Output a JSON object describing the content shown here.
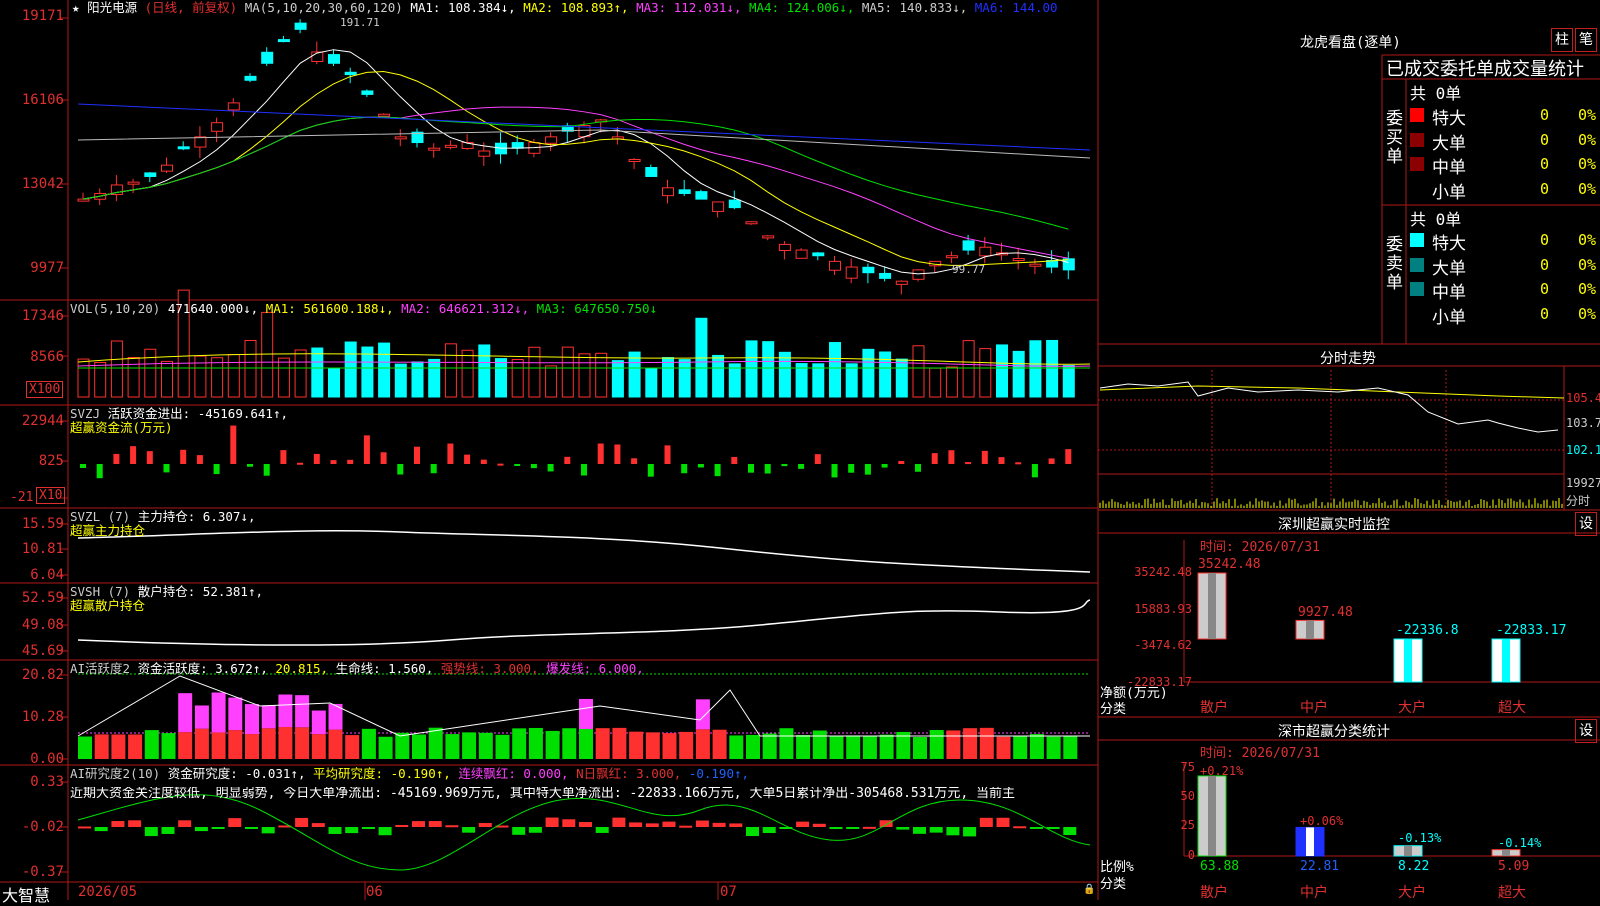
{
  "colors": {
    "up": "#ff3030",
    "down": "#00ffff",
    "grid": "#b01818",
    "white": "#ffffff",
    "yellow": "#ffff00",
    "magenta": "#ff40ff",
    "green": "#00e000",
    "blue": "#2030ff",
    "gray": "#bbbbbb"
  },
  "kline": {
    "stock_star": "★",
    "stock_name": "阳光电源",
    "mode": "(日线, 前复权)",
    "ma_label": "MA(5,10,20,30,60,120)",
    "ma1": "MA1: 108.384↓,",
    "ma2": "MA2: 108.893↑,",
    "ma3": "MA3: 112.031↓,",
    "ma4": "MA4: 124.006↓,",
    "ma5": "MA5: 140.833↓,",
    "ma6": "MA6: 144.00",
    "axis": [
      "19171",
      "16106",
      "13042",
      "9977"
    ],
    "high_mark": "191.71",
    "low_mark": "99.77"
  },
  "vol": {
    "title": "VOL(5,10,20)",
    "v": "471640.000↓,",
    "ma1": "MA1: 561600.188↓,",
    "ma2": "MA2: 646621.312↓,",
    "ma3": "MA3: 647650.750↓",
    "axis": [
      "17346",
      "8566"
    ],
    "unit": "X100"
  },
  "svzj": {
    "title": "SVZJ",
    "value": "活跃资金进出: -45169.641↑,",
    "sub": "超赢资金流(万元)",
    "axis": [
      "22944",
      "825",
      "-21"
    ],
    "unit": "X10"
  },
  "svzl": {
    "title": "SVZL (7)",
    "value": "主力持仓: 6.307↓,",
    "sub": "超赢主力持仓",
    "axis": [
      "15.59",
      "10.81",
      "6.04"
    ]
  },
  "svsh": {
    "title": "SVSH (7)",
    "value": "散户持仓: 52.381↑,",
    "sub": "超赢散户持仓",
    "axis": [
      "52.59",
      "49.08",
      "45.69"
    ]
  },
  "ai_active": {
    "title": "AI活跃度2",
    "v1": "资金活跃度: 3.672↑,",
    "v2": "20.815,",
    "v3": "生命线: 1.560,",
    "v4": "强势线: 3.000,",
    "v5": "爆发线: 6.000,",
    "axis": [
      "20.82",
      "10.28",
      "0.00"
    ]
  },
  "ai_research": {
    "title": "AI研究度2(10)",
    "v1": "资金研究度: -0.031↑,",
    "v2": "平均研究度: -0.190↑,",
    "v3": "连续飘红: 0.000,",
    "v4": "N日飘红: 3.000,",
    "v5": "-0.190↑,",
    "commentary": "近期大资金关注度较低, 明显弱势, 今日大单净流出: -45169.969万元, 其中特大单净流出: -22833.166万元, 大单5日累计净出-305468.531万元, 当前主",
    "axis": [
      "0.33",
      "-0.02",
      "-0.37"
    ]
  },
  "dates": [
    "2026/05",
    "06",
    "07"
  ],
  "brand": "大智慧",
  "lhb": {
    "title": "龙虎看盘(逐单)",
    "btn_zhu": "柱",
    "btn_bi": "笔",
    "header": "已成交委托单成交量统计",
    "buy_label": "委买单",
    "sell_label": "委卖单",
    "buy_total": "共 0单",
    "sell_total": "共 0单",
    "buy_rows": [
      {
        "name": "特大",
        "qty": "0",
        "pct": "0%"
      },
      {
        "name": "大单",
        "qty": "0",
        "pct": "0%"
      },
      {
        "name": "中单",
        "qty": "0",
        "pct": "0%"
      },
      {
        "name": "小单",
        "qty": "0",
        "pct": "0%"
      }
    ],
    "sell_rows": [
      {
        "name": "特大",
        "qty": "0",
        "pct": "0%"
      },
      {
        "name": "大单",
        "qty": "0",
        "pct": "0%"
      },
      {
        "name": "中单",
        "qty": "0",
        "pct": "0%"
      },
      {
        "name": "小单",
        "qty": "0",
        "pct": "0%"
      }
    ]
  },
  "intraday": {
    "title": "分时走势",
    "axis": [
      "105.4",
      "103.7",
      "102.1",
      "19927"
    ],
    "vol_unit": "分时"
  },
  "sz_monitor": {
    "title": "深圳超赢实时监控",
    "btn": "设",
    "time": "时间: 2026/07/31",
    "axis": [
      "35242.48",
      "15883.93",
      "-3474.62",
      "-22833.17"
    ],
    "ylabel": "净额(万元)",
    "xlabel": "分类",
    "categories": [
      "散户",
      "中户",
      "大户",
      "超大"
    ],
    "values": [
      35242.48,
      9927.48,
      -22336.8,
      -22833.17
    ],
    "value_labels": [
      "35242.48",
      "9927.48",
      "-22336.8",
      "-22833.17"
    ]
  },
  "sz_class": {
    "title": "深市超赢分类统计",
    "btn": "设",
    "time": "时间: 2026/07/31",
    "axis": [
      "75",
      "50",
      "25",
      "0"
    ],
    "ylabel": "比例%",
    "xlabel": "分类",
    "categories": [
      "散户",
      "中户",
      "大户",
      "超大"
    ],
    "ratios": [
      63.88,
      22.81,
      8.22,
      5.09
    ],
    "ratio_labels": [
      "63.88",
      "22.81",
      "8.22",
      "5.09"
    ],
    "changes": [
      "+0.21%",
      "+0.06%",
      "-0.13%",
      "-0.14%"
    ]
  }
}
